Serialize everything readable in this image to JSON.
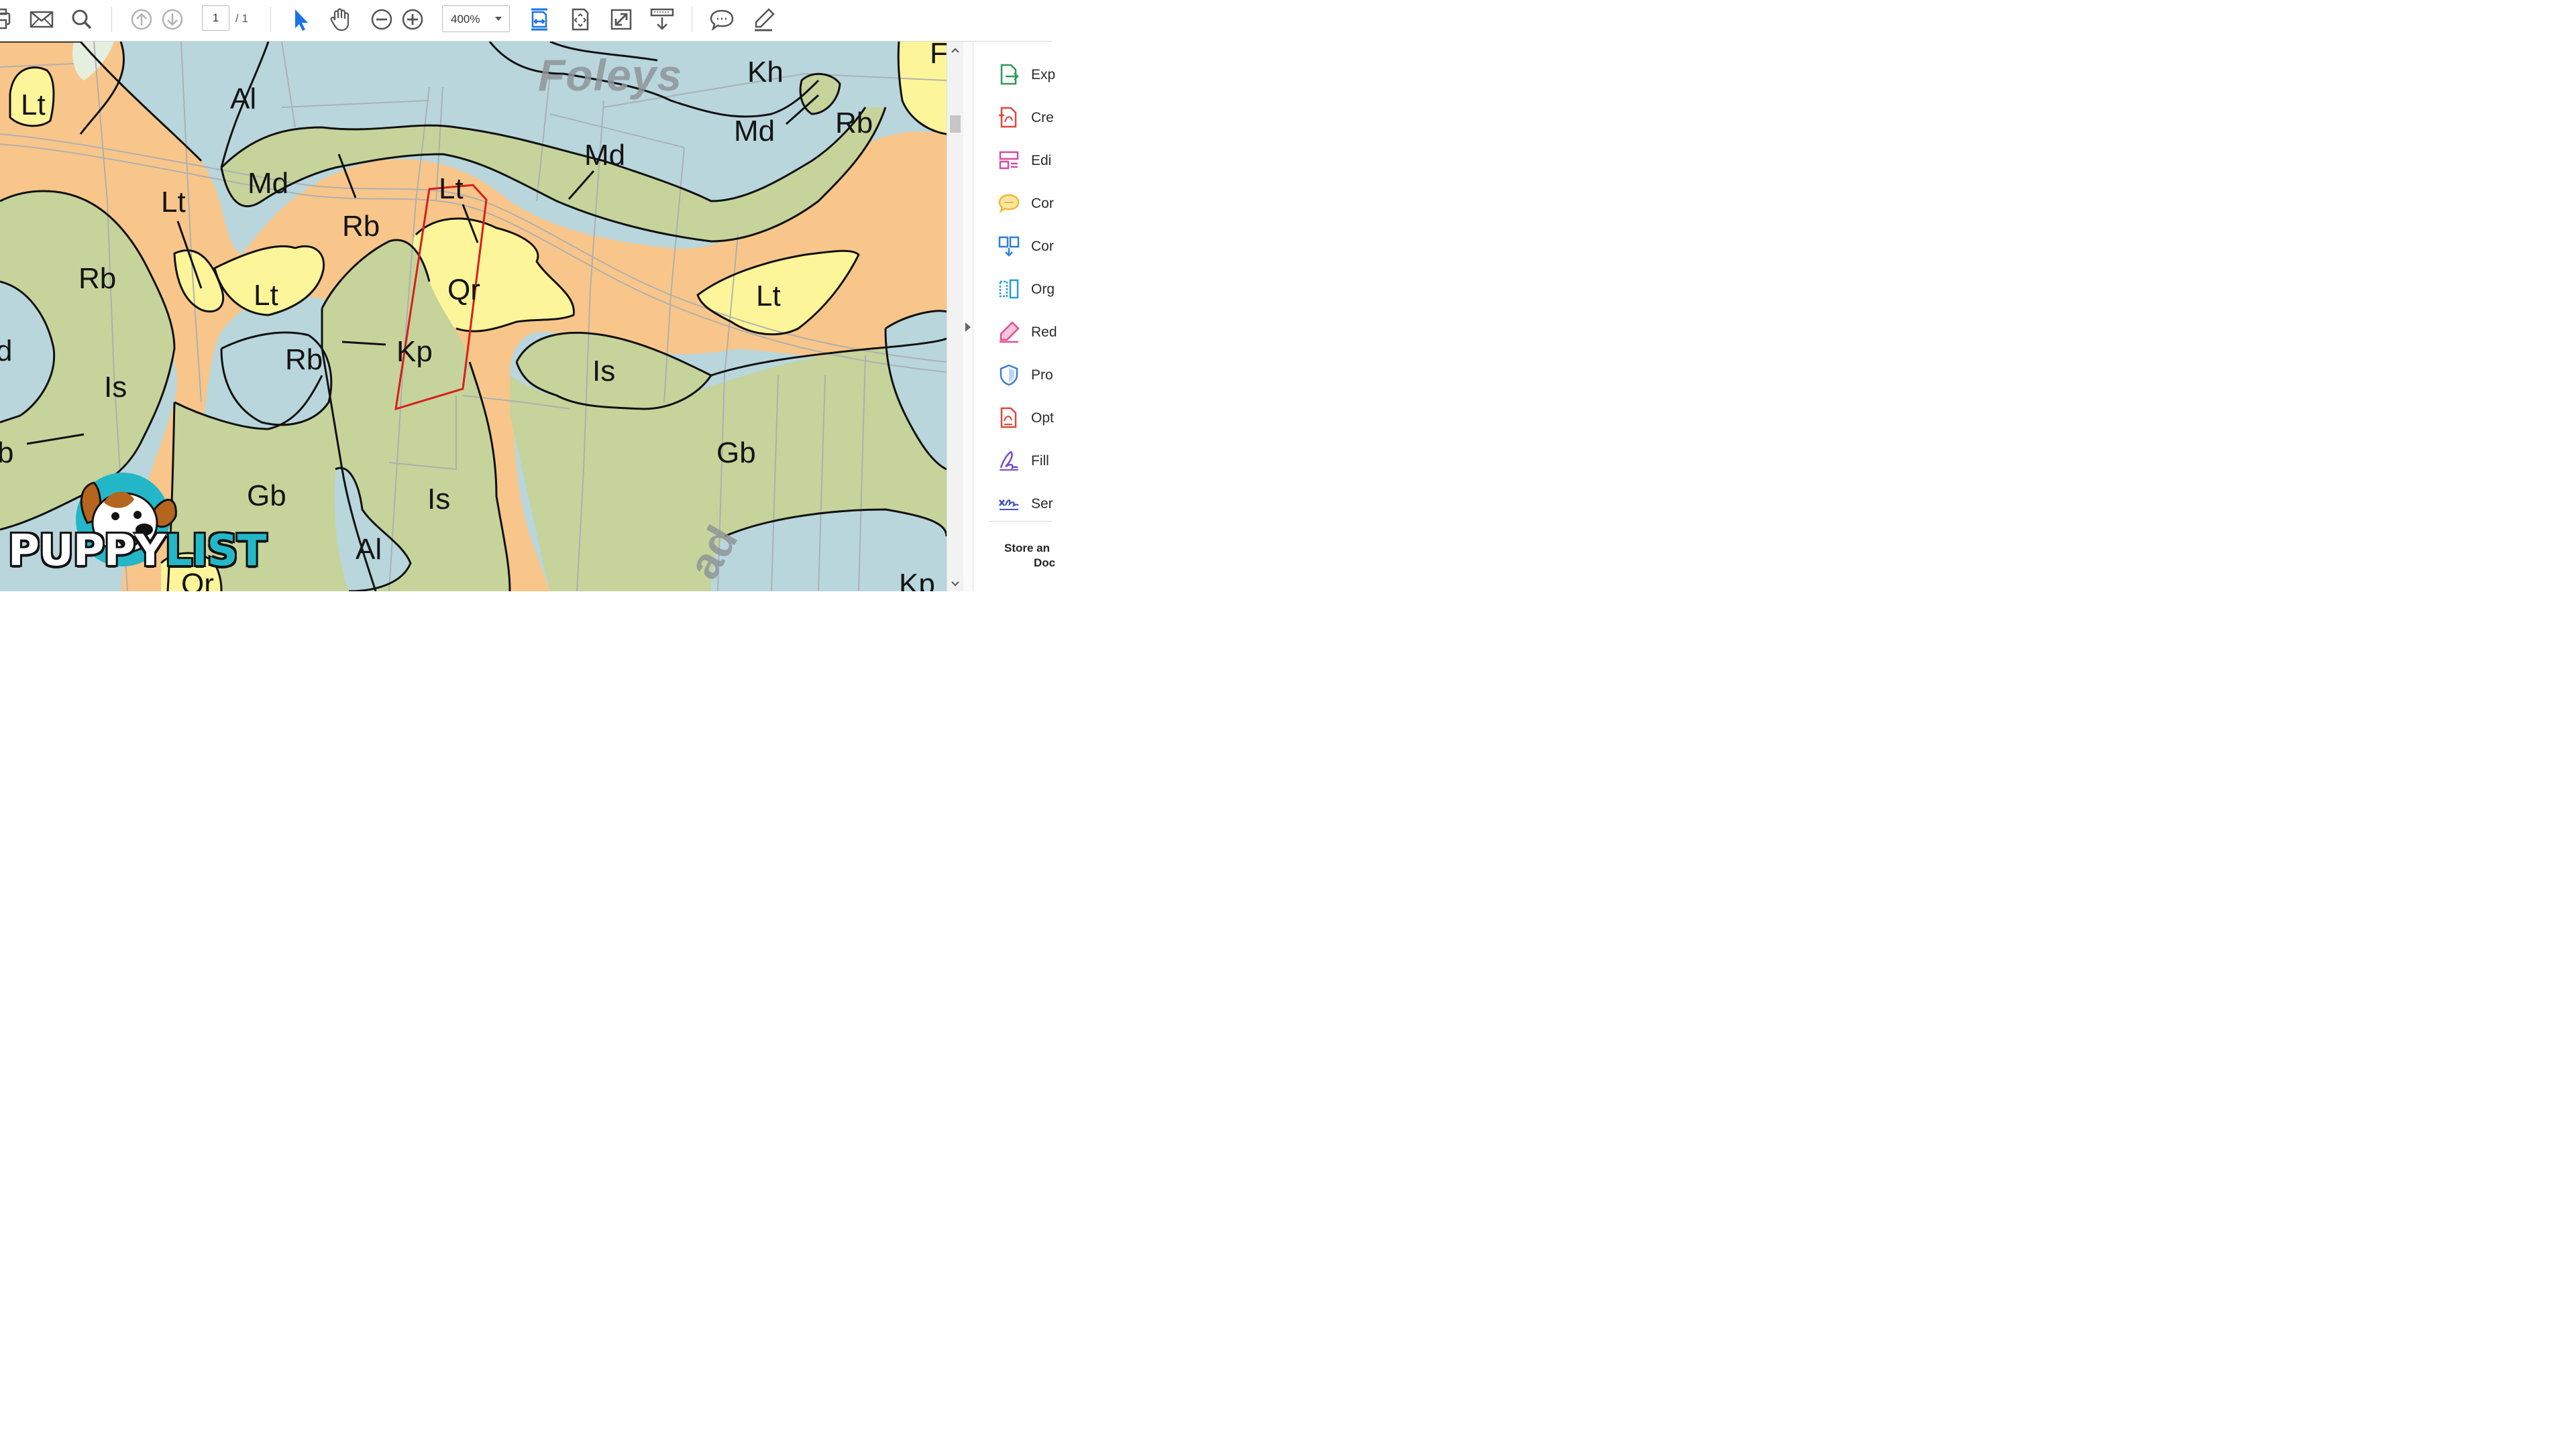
{
  "toolbar": {
    "page_current": "1",
    "page_total": "/ 1",
    "zoom": "400%",
    "icons": [
      "print-icon",
      "mail-icon",
      "search-icon",
      "page-up-icon",
      "page-down-icon",
      "select-arrow-icon",
      "hand-icon",
      "zoom-out-icon",
      "zoom-in-icon",
      "fit-width-icon",
      "fit-page-icon",
      "full-screen-icon",
      "scroll-mode-icon",
      "comment-icon",
      "highlight-pen-icon"
    ],
    "accent": "#1a73e8"
  },
  "map": {
    "road_names": [
      "Foleys",
      "ad"
    ],
    "units": {
      "Lt_1": "Lt",
      "Al_1": "Al",
      "Md_1": "Md",
      "Lt_2": "Lt",
      "Rb_1": "Rb",
      "Lt_3": "Lt",
      "Rb_2": "Rb",
      "Lt_4": "Lt",
      "Qr_1": "Qr",
      "Md_2": "Md",
      "Kh": "Kh",
      "Md_3": "Md",
      "Rb_3": "Rb",
      "Lt_5": "Lt",
      "Kp_1": "Kp",
      "Rb_4": "Rb",
      "Is_1": "Is",
      "Is_2": "Is",
      "Gb_1": "Gb",
      "Gb_2": "Gb",
      "Is_3": "Is",
      "Al_2": "Al",
      "Qr_2": "Qr",
      "Kp_2": "Kp",
      "F": "F",
      "d": "d",
      "b": "b"
    },
    "colors": {
      "alluvium_blue": "#b8d6dc",
      "orange": "#f8c68a",
      "green": "#c6d39a",
      "yellow": "#fdf59a",
      "boundary_red": "#d81e1e"
    }
  },
  "tools_pane": {
    "items": [
      {
        "label": "Exp",
        "icon": "export-pdf-icon",
        "color": "#2e9a5a"
      },
      {
        "label": "Cre",
        "icon": "create-pdf-icon",
        "color": "#e0463f"
      },
      {
        "label": "Edi",
        "icon": "edit-pdf-icon",
        "color": "#d34aa4"
      },
      {
        "label": "Cor",
        "icon": "comment-tool-icon",
        "color": "#f2b632"
      },
      {
        "label": "Cor",
        "icon": "combine-files-icon",
        "color": "#2f7fd4"
      },
      {
        "label": "Org",
        "icon": "organize-pages-icon",
        "color": "#2a9cd4"
      },
      {
        "label": "Red",
        "icon": "redact-icon",
        "color": "#e0508f"
      },
      {
        "label": "Pro",
        "icon": "protect-icon",
        "color": "#3a7fd0"
      },
      {
        "label": "Opt",
        "icon": "optimize-pdf-icon",
        "color": "#e0463f"
      },
      {
        "label": "Fill",
        "icon": "fill-sign-icon",
        "color": "#7b4bc8"
      },
      {
        "label": "Ser",
        "icon": "send-for-signature-icon",
        "color": "#3a53b8"
      }
    ],
    "store_text_1": "Store an",
    "store_text_2": "Doc"
  },
  "logo": {
    "text_a": "PUPPY",
    "text_b": "LIST"
  }
}
